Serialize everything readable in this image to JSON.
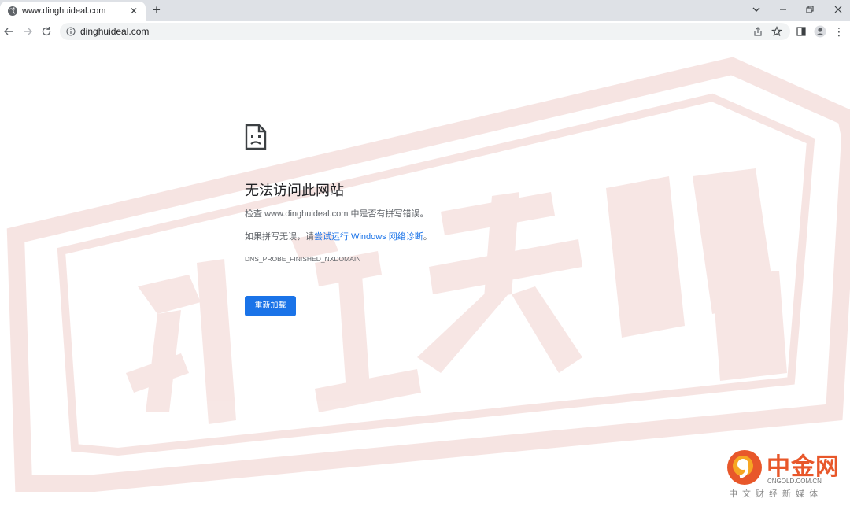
{
  "tab": {
    "title": "www.dinghuideal.com",
    "favicon": "globe-icon",
    "close_glyph": "✕"
  },
  "new_tab_glyph": "+",
  "window_controls": {
    "dropdown_glyph": "⌄",
    "minimize_glyph": "—",
    "restore_glyph": "❐",
    "close_glyph": "✕"
  },
  "toolbar": {
    "back_glyph": "←",
    "forward_glyph": "→",
    "reload_glyph": "↻",
    "url": "dinghuideal.com",
    "menu_glyph": "⋮"
  },
  "error": {
    "title": "无法访问此网站",
    "check_prefix": "检查 ",
    "check_domain": "www.dinghuideal.com",
    "check_suffix": " 中是否有拼写错误。",
    "suggest_prefix": "如果拼写无误，请",
    "suggest_link": "尝试运行 Windows 网络诊断",
    "suggest_suffix": "。",
    "code": "DNS_PROBE_FINISHED_NXDOMAIN",
    "reload_label": "重新加载"
  },
  "watermark_logo": {
    "name": "中金网",
    "url": "CNGOLD.COM.CN",
    "subtitle": "中文财经新媒体"
  },
  "colors": {
    "accent": "#1a73e8",
    "watermark_red": "#c0392b",
    "logo_orange": "#e8572a"
  }
}
